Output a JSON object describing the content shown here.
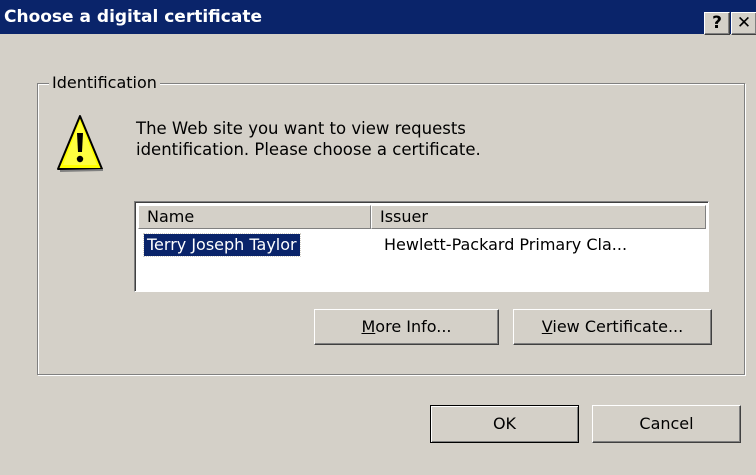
{
  "window": {
    "title": "Choose a digital certificate",
    "help_glyph": "?",
    "close_glyph": "✕"
  },
  "group": {
    "label": "Identification"
  },
  "message": {
    "line1": "The Web site you want to view requests",
    "line2": "identification. Please choose a certificate."
  },
  "icons": {
    "warning": "warning-icon"
  },
  "certificate_list": {
    "columns": [
      "Name",
      "Issuer"
    ],
    "rows": [
      {
        "name": "Terry Joseph Taylor",
        "issuer": "Hewlett-Packard Primary Cla...",
        "selected": true
      }
    ]
  },
  "buttons": {
    "more_info": {
      "mnemonic": "M",
      "rest": "ore Info..."
    },
    "view_certificate": {
      "mnemonic": "V",
      "rest": "iew Certificate..."
    },
    "ok": "OK",
    "cancel": "Cancel"
  },
  "colors": {
    "titlebar": "#0a246a",
    "face": "#d4d0c8",
    "selection": "#0a246a"
  }
}
